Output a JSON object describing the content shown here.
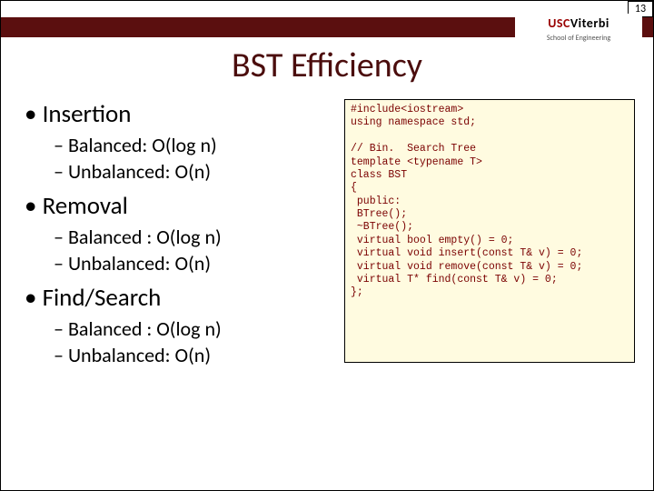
{
  "page_number": "13",
  "logo": {
    "usc": "USC",
    "viterbi": "Viterbi",
    "sub": "School of Engineering"
  },
  "title": "BST Efficiency",
  "bullets": [
    {
      "label": "Insertion",
      "sub": [
        {
          "text": "Balanced: O(log n)"
        },
        {
          "text": "Unbalanced: O(n)"
        }
      ]
    },
    {
      "label": "Removal",
      "sub": [
        {
          "text": "Balanced : O(log n)"
        },
        {
          "text": "Unbalanced: O(n)"
        }
      ]
    },
    {
      "label": "Find/Search",
      "sub": [
        {
          "text": "Balanced : O(log n)"
        },
        {
          "text": "Unbalanced: O(n)"
        }
      ]
    }
  ],
  "code": "#include<iostream>\nusing namespace std;\n\n// Bin.  Search Tree\ntemplate <typename T>\nclass BST\n{\n public:\n BTree();\n ~BTree();\n virtual bool empty() = 0;\n virtual void insert(const T& v) = 0;\n virtual void remove(const T& v) = 0;\n virtual T* find(const T& v) = 0;\n};"
}
